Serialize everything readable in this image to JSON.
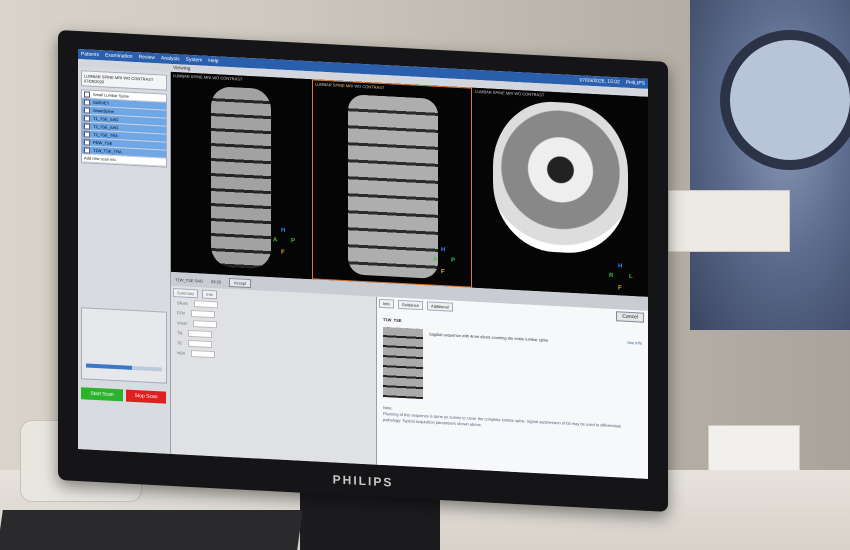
{
  "screen": {
    "menubar": {
      "menus": [
        "Patients",
        "Examination",
        "Review",
        "Analysis",
        "System",
        "Help"
      ],
      "datetime": "07/09/2026, 15:02",
      "brand": "PHILIPS"
    },
    "toolbar": {
      "status": "Viewing"
    },
    "exam": {
      "card_title": "LUMBAR SPINE MRI WO CONTRAST",
      "date": "07/09/2026",
      "list_items": [
        "Small Lumbar Spine",
        "SURVEY",
        "SmartSpine",
        "T1_TSE_SAG",
        "T2_TSE_SAG",
        "T2_TSE_TRA",
        "PDW_TSE",
        "T1W_TSE_TRA"
      ],
      "add_scan": "Add new scan etc."
    },
    "viewports": [
      {
        "label": "LUMBAR SPINE MRI WO CONTRAST"
      },
      {
        "label": "LUMBAR SPINE MRI WO CONTRAST"
      },
      {
        "label": "LUMBAR SPINE MRI WO CONTRAST"
      }
    ],
    "orientation": {
      "top": "H",
      "left": "A",
      "right": "P",
      "bottom": "F",
      "axial_left": "R",
      "axial_right": "L"
    },
    "scan_info": {
      "sequence": "T1W_TSE SAG",
      "duration": "03:20"
    },
    "buttons": {
      "accept": "Accept",
      "cancel": "Cancel",
      "start": "Start Scan",
      "stop": "Stop Scan"
    },
    "progress": 0.6,
    "params": {
      "tabs": [
        "Summary",
        "Info"
      ],
      "rows": [
        "Slices",
        "FOV",
        "Voxel",
        "TR",
        "TE",
        "NSA"
      ]
    },
    "info": {
      "tabs": [
        "Info",
        "Guidance",
        "Additional"
      ],
      "title": "T1W_TSE",
      "see_info": "See Info",
      "description": "Sagittal sequence with 4mm sliced covering the entire lumbar spine",
      "notes_title": "Note:",
      "notes": "Planning of this sequence is done on survey to cover the complete lumbar spine. Signal suppression of fat may be used to differentiate pathology. Typical acquisition parameters shown above."
    },
    "monitor_brand": "PHILIPS"
  }
}
